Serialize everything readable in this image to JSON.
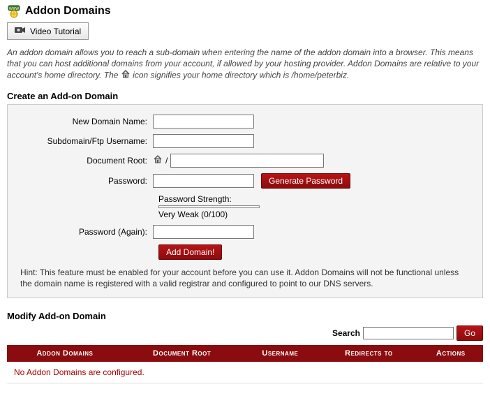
{
  "header": {
    "title": "Addon Domains",
    "video_button": "Video Tutorial"
  },
  "intro": {
    "part1": "An addon domain allows you to reach a sub-domain when entering the name of the addon domain into a browser. This means that you can host additional domains from your account, if allowed by your hosting provider. Addon Domains are relative to your account's home directory. The ",
    "part2": " icon signifies your home directory which is /home/peterbiz."
  },
  "create": {
    "title": "Create an Add-on Domain",
    "labels": {
      "new_domain": "New Domain Name:",
      "subdomain": "Subdomain/Ftp Username:",
      "docroot": "Document Root:",
      "docroot_prefix": "/",
      "password": "Password:",
      "generate": "Generate Password",
      "strength_label": "Password Strength:",
      "strength_value": "Very Weak (0/100)",
      "password_again": "Password (Again):",
      "add": "Add Domain!"
    },
    "hint": "Hint: This feature must be enabled for your account before you can use it. Addon Domains will not be functional unless the domain name is registered with a valid registrar and configured to point to our DNS servers."
  },
  "modify": {
    "title": "Modify Add-on Domain",
    "search_label": "Search",
    "go": "Go",
    "columns": {
      "addon": "Addon Domains",
      "docroot": "Document Root",
      "username": "Username",
      "redirects": "Redirects to",
      "actions": "Actions"
    },
    "empty": "No Addon Domains are configured."
  }
}
